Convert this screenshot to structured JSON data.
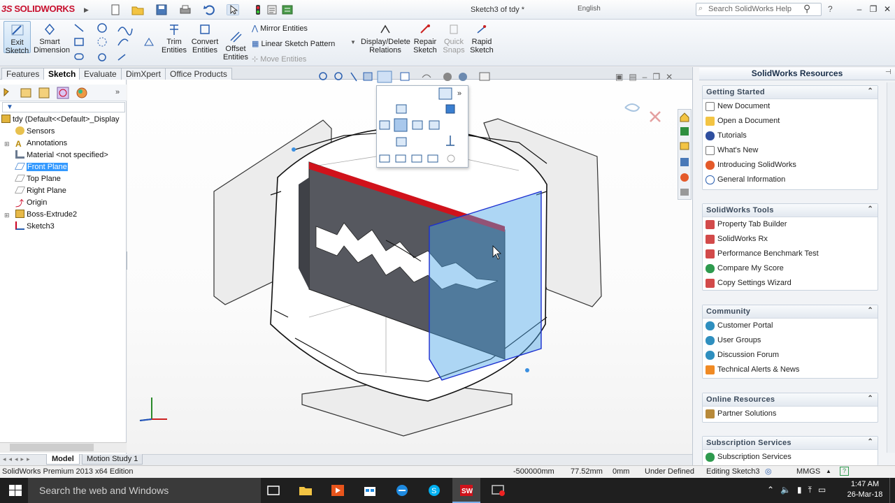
{
  "app": {
    "brand": "SOLIDWORKS",
    "doc_title": "Sketch3 of tdy *",
    "language": "English"
  },
  "search": {
    "placeholder": "Search SolidWorks Help"
  },
  "ribbon": {
    "exit_sketch": "Exit Sketch",
    "smart_dimension": "Smart Dimension",
    "trim_entities": "Trim Entities",
    "convert_entities": "Convert Entities",
    "offset_entities": "Offset Entities",
    "mirror_entities": "Mirror Entities",
    "linear_sketch_pattern": "Linear Sketch Pattern",
    "move_entities": "Move Entities",
    "display_delete_relations": "Display/Delete Relations",
    "repair_sketch": "Repair Sketch",
    "quick_snaps": "Quick Snaps",
    "rapid_sketch": "Rapid Sketch"
  },
  "tabs": [
    "Features",
    "Sketch",
    "Evaluate",
    "DimXpert",
    "Office Products"
  ],
  "tree": {
    "root": "tdy  (Default<<Default>_Display",
    "items": [
      "Sensors",
      "Annotations",
      "Material <not specified>",
      "Front Plane",
      "Top Plane",
      "Right Plane",
      "Origin",
      "Boss-Extrude2",
      "Sketch3"
    ]
  },
  "resources": {
    "title": "SolidWorks Resources",
    "sections": [
      {
        "title": "Getting Started",
        "items": [
          "New Document",
          "Open a Document",
          "Tutorials",
          "What's New",
          "Introducing SolidWorks",
          "General Information"
        ]
      },
      {
        "title": "SolidWorks Tools",
        "items": [
          "Property Tab Builder",
          "SolidWorks Rx",
          "Performance Benchmark Test",
          "Compare My Score",
          "Copy Settings Wizard"
        ]
      },
      {
        "title": "Community",
        "items": [
          "Customer Portal",
          "User Groups",
          "Discussion Forum",
          "Technical Alerts & News"
        ]
      },
      {
        "title": "Online Resources",
        "items": [
          "Partner Solutions"
        ]
      },
      {
        "title": "Subscription Services",
        "items": [
          "Subscription Services"
        ]
      }
    ]
  },
  "model_tabs": [
    "Model",
    "Motion Study 1"
  ],
  "status": {
    "edition": "SolidWorks Premium 2013 x64 Edition",
    "x": "-500000mm",
    "y": "77.52mm",
    "z": "0mm",
    "state": "Under Defined",
    "editing": "Editing Sketch3",
    "units": "MMGS"
  },
  "taskbar": {
    "search_placeholder": "Search the web and Windows",
    "time": "1:47 AM",
    "date": "26-Mar-18"
  },
  "colors": {
    "plane_blue": "#4aa3e6",
    "accent_red": "#d0121b",
    "part_dark": "#5a5c63"
  }
}
